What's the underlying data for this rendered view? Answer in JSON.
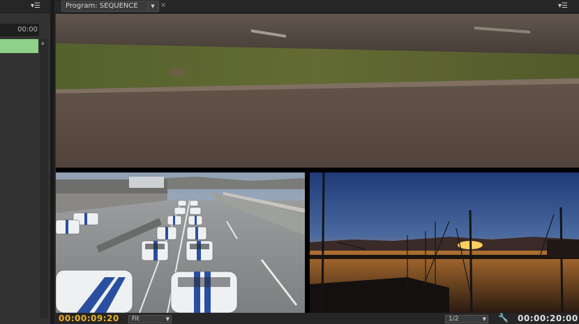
{
  "left_panel": {
    "timecode": "00:00",
    "menu_icon": "panel-menu-icon"
  },
  "program": {
    "tab_label": "Program: SEQUENCE",
    "dropdown_glyph": "▼",
    "close_glyph": "×",
    "menu_glyph": "▾☰"
  },
  "controls": {
    "current_timecode": "00:00:09:20",
    "zoom_value": "Fit",
    "resolution_value": "1/2",
    "duration_timecode": "00:00:20:00",
    "wrench_icon": "settings-wrench-icon"
  },
  "colors": {
    "timecode_accent": "#e8b327",
    "clip_green": "#8fd18a"
  }
}
